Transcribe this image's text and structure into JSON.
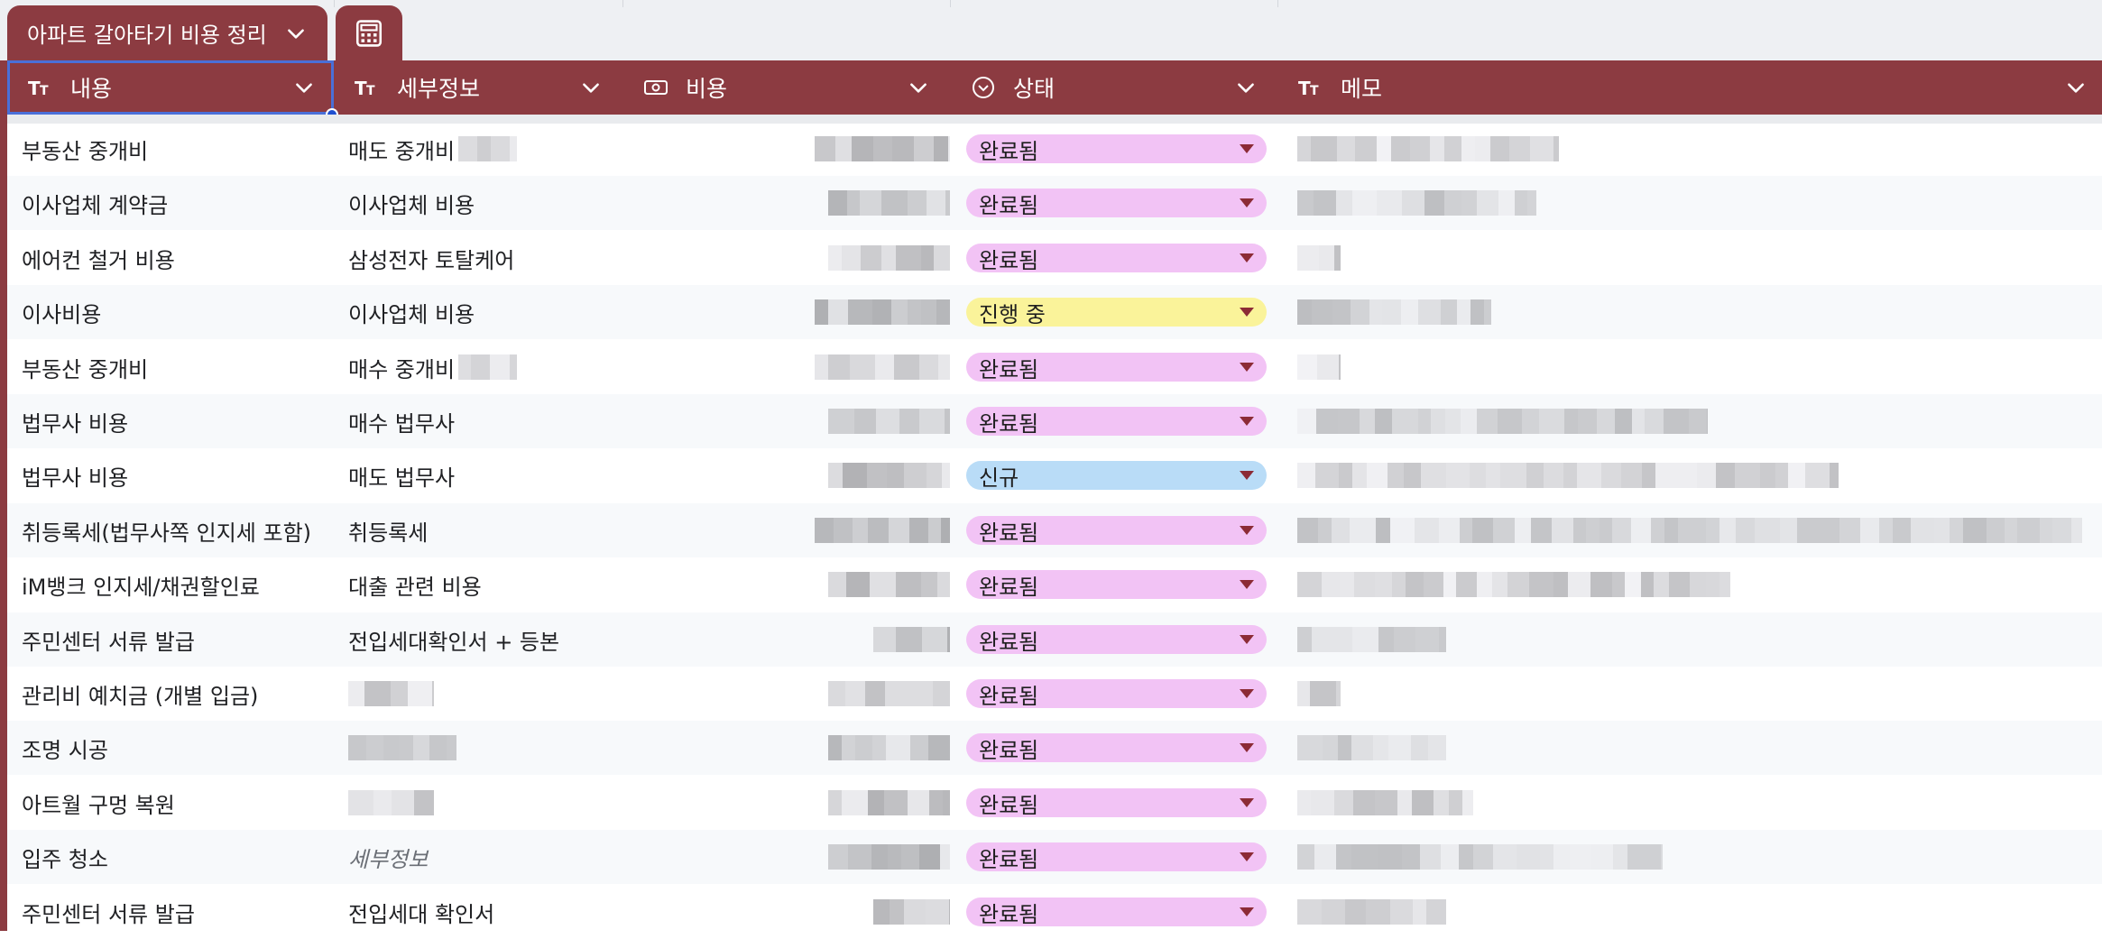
{
  "sheet_tab": {
    "title": "아파트 갈아타기 비용 정리",
    "chevron_icon": "chevron-down-icon",
    "extra_tab_icon": "calculator-icon"
  },
  "colors": {
    "header_bg": "#8c3b41",
    "status_done": "#f2c3f5",
    "status_in_progress": "#faf39a",
    "status_new": "#b9dcf7",
    "selection": "#4a6fd8"
  },
  "columns": [
    {
      "label": "내용",
      "icon": "text-type-icon"
    },
    {
      "label": "세부정보",
      "icon": "text-type-icon"
    },
    {
      "label": "비용",
      "icon": "money-icon"
    },
    {
      "label": "상태",
      "icon": "dropdown-type-icon"
    },
    {
      "label": "메모",
      "icon": "text-type-icon"
    }
  ],
  "rows": [
    {
      "name": "부동산 중개비",
      "detail": "매도 중개비",
      "detail_redacted": true,
      "status": "완료됨",
      "status_type": "done"
    },
    {
      "name": "이사업체 계약금",
      "detail": "이사업체 비용",
      "status": "완료됨",
      "status_type": "done"
    },
    {
      "name": "에어컨 철거 비용",
      "detail": "삼성전자 토탈케어",
      "status": "완료됨",
      "status_type": "done"
    },
    {
      "name": "이사비용",
      "detail": "이사업체 비용",
      "status": "진행 중",
      "status_type": "in_progress"
    },
    {
      "name": "부동산 중개비",
      "detail": "매수 중개비",
      "detail_redacted": true,
      "status": "완료됨",
      "status_type": "done"
    },
    {
      "name": "법무사 비용",
      "detail": "매수 법무사",
      "status": "완료됨",
      "status_type": "done"
    },
    {
      "name": "법무사 비용",
      "detail": "매도 법무사",
      "status": "신규",
      "status_type": "new"
    },
    {
      "name": "취등록세(법무사쪽 인지세 포함)",
      "detail": "취등록세",
      "status": "완료됨",
      "status_type": "done"
    },
    {
      "name": "iM뱅크 인지세/채권할인료",
      "detail": "대출 관련 비용",
      "status": "완료됨",
      "status_type": "done"
    },
    {
      "name": "주민센터 서류 발급",
      "detail": "전입세대확인서 + 등본",
      "status": "완료됨",
      "status_type": "done"
    },
    {
      "name": "관리비 예치금 (개별 입금)",
      "detail": "",
      "detail_redacted": true,
      "status": "완료됨",
      "status_type": "done"
    },
    {
      "name": "조명 시공",
      "detail": "",
      "detail_redacted": true,
      "status": "완료됨",
      "status_type": "done"
    },
    {
      "name": "아트월 구멍 복원",
      "detail": "",
      "detail_redacted": true,
      "status": "완료됨",
      "status_type": "done"
    },
    {
      "name": "입주 청소",
      "detail": "세부정보",
      "detail_placeholder": true,
      "status": "완료됨",
      "status_type": "done"
    },
    {
      "name": "주민센터 서류 발급",
      "detail": "전입세대 확인서",
      "status": "완료됨",
      "status_type": "done"
    }
  ]
}
